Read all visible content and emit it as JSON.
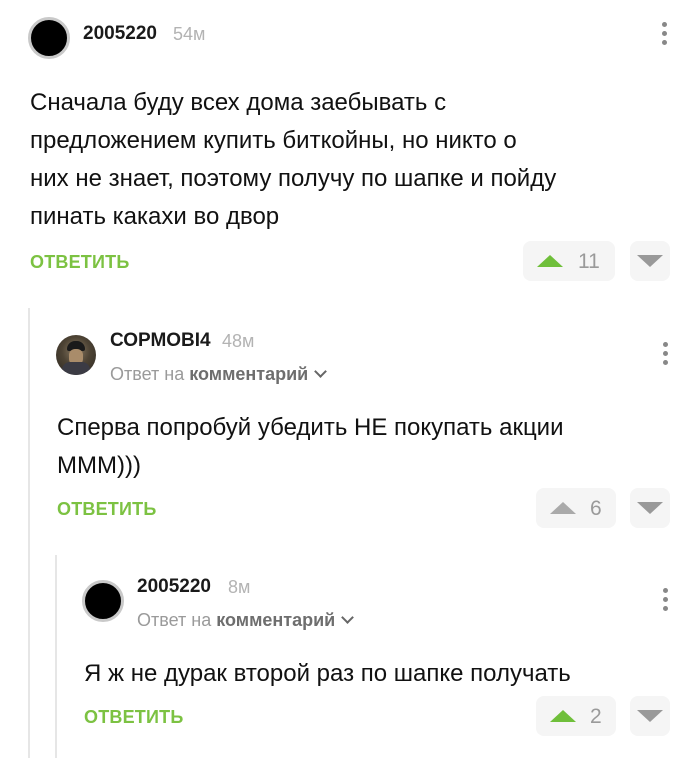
{
  "comments": [
    {
      "author": "2005220",
      "time": "54м",
      "text_lines": [
        "Сначала буду всех дома заебывать с",
        "предложением купить биткойны, но никто о",
        "них не знает, поэтому получу по шапке и пойду",
        "пинать какахи во двор"
      ],
      "reply_label": "ОТВЕТИТЬ",
      "rating": "11",
      "avatar_icon": "dark-circle-avatar"
    },
    {
      "author": "СОРМОВI4",
      "time": "48м",
      "reply_prefix": "Ответ на",
      "reply_link": "комментарий",
      "text_lines": [
        "Сперва попробуй убедить НЕ покупать акции",
        "МММ)))"
      ],
      "reply_label": "ОТВЕТИТЬ",
      "rating": "6",
      "avatar_icon": "photo-avatar"
    },
    {
      "author": "2005220",
      "time": "8м",
      "reply_prefix": "Ответ на",
      "reply_link": "комментарий",
      "text_lines": [
        "Я ж не дурак второй раз по шапке получать"
      ],
      "reply_label": "ОТВЕТИТЬ",
      "rating": "2",
      "avatar_icon": "dark-circle-avatar"
    }
  ],
  "colors": {
    "accent_green": "#7cc242",
    "upvote_active": "#6fbf3a",
    "muted_grey": "#9a9a9a"
  }
}
